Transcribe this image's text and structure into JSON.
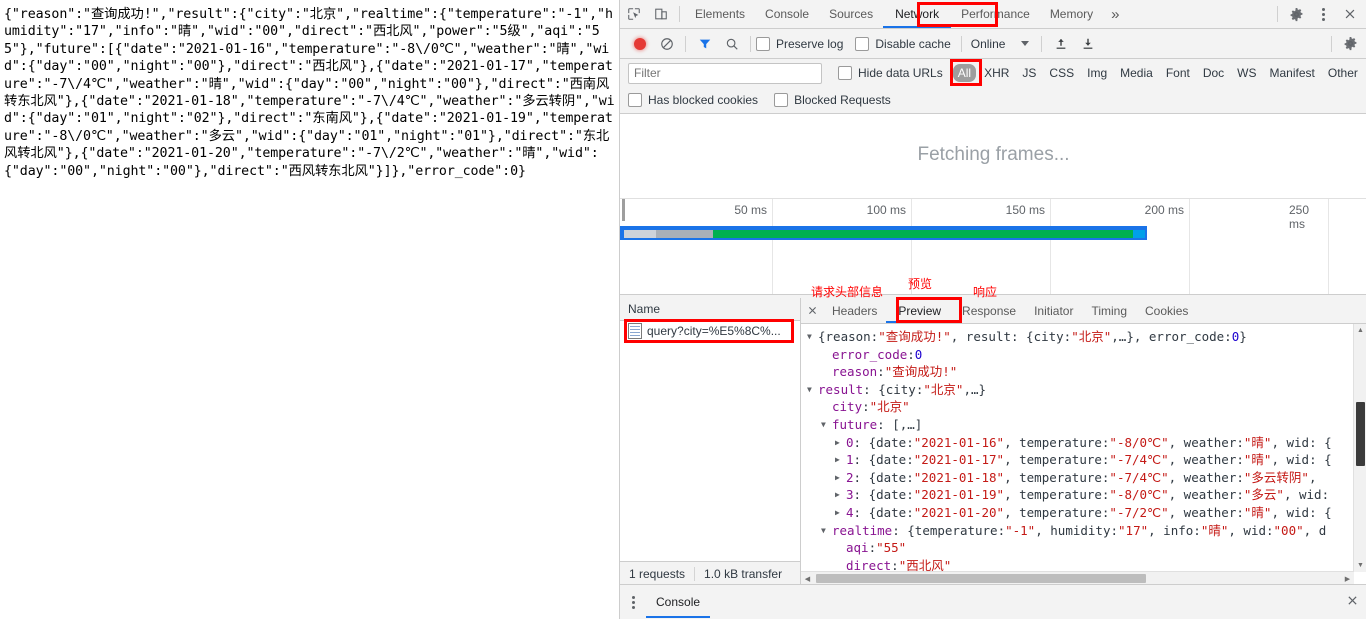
{
  "page": {
    "raw_json": "{\"reason\":\"查询成功!\",\"result\":{\"city\":\"北京\",\"realtime\":{\"temperature\":\"-1\",\"humidity\":\"17\",\"info\":\"晴\",\"wid\":\"00\",\"direct\":\"西北风\",\"power\":\"5级\",\"aqi\":\"55\"},\"future\":[{\"date\":\"2021-01-16\",\"temperature\":\"-8\\/0℃\",\"weather\":\"晴\",\"wid\":{\"day\":\"00\",\"night\":\"00\"},\"direct\":\"西北风\"},{\"date\":\"2021-01-17\",\"temperature\":\"-7\\/4℃\",\"weather\":\"晴\",\"wid\":{\"day\":\"00\",\"night\":\"00\"},\"direct\":\"西南风转东北风\"},{\"date\":\"2021-01-18\",\"temperature\":\"-7\\/4℃\",\"weather\":\"多云转阴\",\"wid\":{\"day\":\"01\",\"night\":\"02\"},\"direct\":\"东南风\"},{\"date\":\"2021-01-19\",\"temperature\":\"-8\\/0℃\",\"weather\":\"多云\",\"wid\":{\"day\":\"01\",\"night\":\"01\"},\"direct\":\"东北风转北风\"},{\"date\":\"2021-01-20\",\"temperature\":\"-7\\/2℃\",\"weather\":\"晴\",\"wid\":{\"day\":\"00\",\"night\":\"00\"},\"direct\":\"西风转东北风\"}]},\"error_code\":0}"
  },
  "devtools": {
    "tabs": [
      {
        "label": "Elements",
        "active": false
      },
      {
        "label": "Console",
        "active": false
      },
      {
        "label": "Sources",
        "active": false
      },
      {
        "label": "Network",
        "active": true
      },
      {
        "label": "Performance",
        "active": false
      },
      {
        "label": "Memory",
        "active": false
      }
    ],
    "more_tabs_label": "»",
    "icons": {
      "inspect": "inspect-element-icon",
      "device": "device-toolbar-icon",
      "settings": "gear-icon",
      "menu": "kebab-menu-icon",
      "close": "close-icon"
    }
  },
  "network_toolbar": {
    "record_title": "record-button",
    "clear_title": "clear-button",
    "filter_title": "filter-button",
    "search_title": "search-button",
    "preserve_log": "Preserve log",
    "disable_cache": "Disable cache",
    "throttle_value": "Online",
    "import_title": "import-har-button",
    "export_title": "export-har-button",
    "settings_title": "network-settings-icon"
  },
  "filter_bar": {
    "filter_placeholder": "Filter",
    "filter_value": "",
    "hide_data_urls": "Hide data URLs",
    "types": [
      {
        "label": "All",
        "selected": true
      },
      {
        "label": "XHR",
        "selected": false
      },
      {
        "label": "JS",
        "selected": false
      },
      {
        "label": "CSS",
        "selected": false
      },
      {
        "label": "Img",
        "selected": false
      },
      {
        "label": "Media",
        "selected": false
      },
      {
        "label": "Font",
        "selected": false
      },
      {
        "label": "Doc",
        "selected": false
      },
      {
        "label": "WS",
        "selected": false
      },
      {
        "label": "Manifest",
        "selected": false
      },
      {
        "label": "Other",
        "selected": false
      }
    ],
    "has_blocked_cookies": "Has blocked cookies",
    "blocked_requests": "Blocked Requests"
  },
  "overview": {
    "fetching_text": "Fetching frames...",
    "tick_labels": [
      "50 ms",
      "100 ms",
      "150 ms",
      "200 ms",
      "250 ms"
    ]
  },
  "requests": {
    "name_header": "Name",
    "rows": [
      {
        "name": "query?city=%E5%8C%...",
        "icon": "document-icon",
        "selected": true
      }
    ],
    "status_count": "1 requests",
    "status_transfer": "1.0 kB transfer"
  },
  "detail": {
    "tabs": [
      {
        "label": "Headers",
        "active": false
      },
      {
        "label": "Preview",
        "active": true
      },
      {
        "label": "Response",
        "active": false
      },
      {
        "label": "Initiator",
        "active": false
      },
      {
        "label": "Timing",
        "active": false
      },
      {
        "label": "Cookies",
        "active": false
      }
    ],
    "preview_rows": [
      {
        "indent": 0,
        "tri": "open",
        "parts": [
          {
            "t": "{reason: ",
            "c": "plain"
          },
          {
            "t": "\"查询成功!\"",
            "c": "v-str"
          },
          {
            "t": ", result: {city: ",
            "c": "plain"
          },
          {
            "t": "\"北京\"",
            "c": "v-str"
          },
          {
            "t": ",…}, error_code: ",
            "c": "plain"
          },
          {
            "t": "0",
            "c": "v-num"
          },
          {
            "t": "}",
            "c": "plain"
          }
        ]
      },
      {
        "indent": 1,
        "tri": "none",
        "parts": [
          {
            "t": "error_code",
            "c": "k-name"
          },
          {
            "t": ": ",
            "c": "plain"
          },
          {
            "t": "0",
            "c": "v-num"
          }
        ]
      },
      {
        "indent": 1,
        "tri": "none",
        "parts": [
          {
            "t": "reason",
            "c": "k-name"
          },
          {
            "t": ": ",
            "c": "plain"
          },
          {
            "t": "\"查询成功!\"",
            "c": "v-str"
          }
        ]
      },
      {
        "indent": 0,
        "tri": "open",
        "parts": [
          {
            "t": "result",
            "c": "k-name"
          },
          {
            "t": ": {city: ",
            "c": "plain"
          },
          {
            "t": "\"北京\"",
            "c": "v-str"
          },
          {
            "t": ",…}",
            "c": "plain"
          }
        ]
      },
      {
        "indent": 1,
        "tri": "none",
        "parts": [
          {
            "t": "city",
            "c": "k-name"
          },
          {
            "t": ": ",
            "c": "plain"
          },
          {
            "t": "\"北京\"",
            "c": "v-str"
          }
        ]
      },
      {
        "indent": 1,
        "tri": "open",
        "parts": [
          {
            "t": "future",
            "c": "k-name"
          },
          {
            "t": ": [,…]",
            "c": "plain"
          }
        ]
      },
      {
        "indent": 2,
        "tri": "closed",
        "parts": [
          {
            "t": "0",
            "c": "k-idx"
          },
          {
            "t": ": {date: ",
            "c": "plain"
          },
          {
            "t": "\"2021-01-16\"",
            "c": "v-str"
          },
          {
            "t": ", temperature: ",
            "c": "plain"
          },
          {
            "t": "\"-8/0℃\"",
            "c": "v-str"
          },
          {
            "t": ", weather: ",
            "c": "plain"
          },
          {
            "t": "\"晴\"",
            "c": "v-str"
          },
          {
            "t": ", wid: {",
            "c": "plain"
          }
        ]
      },
      {
        "indent": 2,
        "tri": "closed",
        "parts": [
          {
            "t": "1",
            "c": "k-idx"
          },
          {
            "t": ": {date: ",
            "c": "plain"
          },
          {
            "t": "\"2021-01-17\"",
            "c": "v-str"
          },
          {
            "t": ", temperature: ",
            "c": "plain"
          },
          {
            "t": "\"-7/4℃\"",
            "c": "v-str"
          },
          {
            "t": ", weather: ",
            "c": "plain"
          },
          {
            "t": "\"晴\"",
            "c": "v-str"
          },
          {
            "t": ", wid: {",
            "c": "plain"
          }
        ]
      },
      {
        "indent": 2,
        "tri": "closed",
        "parts": [
          {
            "t": "2",
            "c": "k-idx"
          },
          {
            "t": ": {date: ",
            "c": "plain"
          },
          {
            "t": "\"2021-01-18\"",
            "c": "v-str"
          },
          {
            "t": ", temperature: ",
            "c": "plain"
          },
          {
            "t": "\"-7/4℃\"",
            "c": "v-str"
          },
          {
            "t": ", weather: ",
            "c": "plain"
          },
          {
            "t": "\"多云转阴\"",
            "c": "v-str"
          },
          {
            "t": ",",
            "c": "plain"
          }
        ]
      },
      {
        "indent": 2,
        "tri": "closed",
        "parts": [
          {
            "t": "3",
            "c": "k-idx"
          },
          {
            "t": ": {date: ",
            "c": "plain"
          },
          {
            "t": "\"2021-01-19\"",
            "c": "v-str"
          },
          {
            "t": ", temperature: ",
            "c": "plain"
          },
          {
            "t": "\"-8/0℃\"",
            "c": "v-str"
          },
          {
            "t": ", weather: ",
            "c": "plain"
          },
          {
            "t": "\"多云\"",
            "c": "v-str"
          },
          {
            "t": ", wid:",
            "c": "plain"
          }
        ]
      },
      {
        "indent": 2,
        "tri": "closed",
        "parts": [
          {
            "t": "4",
            "c": "k-idx"
          },
          {
            "t": ": {date: ",
            "c": "plain"
          },
          {
            "t": "\"2021-01-20\"",
            "c": "v-str"
          },
          {
            "t": ", temperature: ",
            "c": "plain"
          },
          {
            "t": "\"-7/2℃\"",
            "c": "v-str"
          },
          {
            "t": ", weather: ",
            "c": "plain"
          },
          {
            "t": "\"晴\"",
            "c": "v-str"
          },
          {
            "t": ", wid: {",
            "c": "plain"
          }
        ]
      },
      {
        "indent": 1,
        "tri": "open",
        "parts": [
          {
            "t": "realtime",
            "c": "k-name"
          },
          {
            "t": ": {temperature: ",
            "c": "plain"
          },
          {
            "t": "\"-1\"",
            "c": "v-str"
          },
          {
            "t": ", humidity: ",
            "c": "plain"
          },
          {
            "t": "\"17\"",
            "c": "v-str"
          },
          {
            "t": ", info: ",
            "c": "plain"
          },
          {
            "t": "\"晴\"",
            "c": "v-str"
          },
          {
            "t": ", wid: ",
            "c": "plain"
          },
          {
            "t": "\"00\"",
            "c": "v-str"
          },
          {
            "t": ", d",
            "c": "plain"
          }
        ]
      },
      {
        "indent": 2,
        "tri": "none",
        "parts": [
          {
            "t": "aqi",
            "c": "k-name"
          },
          {
            "t": ": ",
            "c": "plain"
          },
          {
            "t": "\"55\"",
            "c": "v-str"
          }
        ]
      },
      {
        "indent": 2,
        "tri": "none",
        "parts": [
          {
            "t": "direct",
            "c": "k-name"
          },
          {
            "t": ": ",
            "c": "plain"
          },
          {
            "t": "\"西北风\"",
            "c": "v-str"
          }
        ]
      }
    ]
  },
  "annotations": [
    {
      "text": "请求头部信息",
      "name": "annotation-headers-label"
    },
    {
      "text": "预览",
      "name": "annotation-preview-label"
    },
    {
      "text": "响应",
      "name": "annotation-response-label"
    }
  ],
  "drawer": {
    "tab_label": "Console",
    "close": "×"
  },
  "colors": {
    "accent": "#1a73e8",
    "annotation": "#ff0000",
    "selected_filter_bg": "#9e9e9e",
    "waterfall_green": "#00b050",
    "record_red": "#e53935"
  }
}
